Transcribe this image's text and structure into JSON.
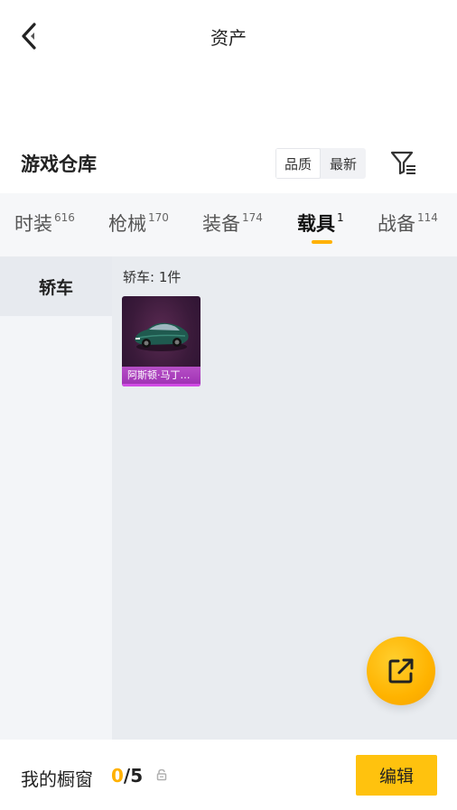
{
  "header": {
    "title": "资产"
  },
  "section": {
    "title": "游戏仓库"
  },
  "sort": {
    "options": [
      "品质",
      "最新"
    ],
    "selected": "品质"
  },
  "tabs": [
    {
      "label": "时装",
      "count": "616"
    },
    {
      "label": "枪械",
      "count": "170"
    },
    {
      "label": "装备",
      "count": "174"
    },
    {
      "label": "载具",
      "count": "1",
      "active": true
    },
    {
      "label": "战备",
      "count": "114"
    }
  ],
  "sidebar": {
    "items": [
      {
        "label": "轿车",
        "active": true
      }
    ]
  },
  "content": {
    "subcategory_label": "轿车: 1件",
    "items": [
      {
        "name": "阿斯顿·马丁D..."
      }
    ]
  },
  "bottom": {
    "shop_label": "我的橱窗",
    "count_current": "0",
    "count_total": "/5",
    "edit_label": "编辑"
  },
  "colors": {
    "accent": "#ffb100",
    "edit_button": "#ffc20e",
    "card_rarity": "#b64fc6"
  },
  "icons": [
    "back-arrow-icon",
    "filter-icon",
    "car-image",
    "share-icon",
    "lock-icon"
  ]
}
